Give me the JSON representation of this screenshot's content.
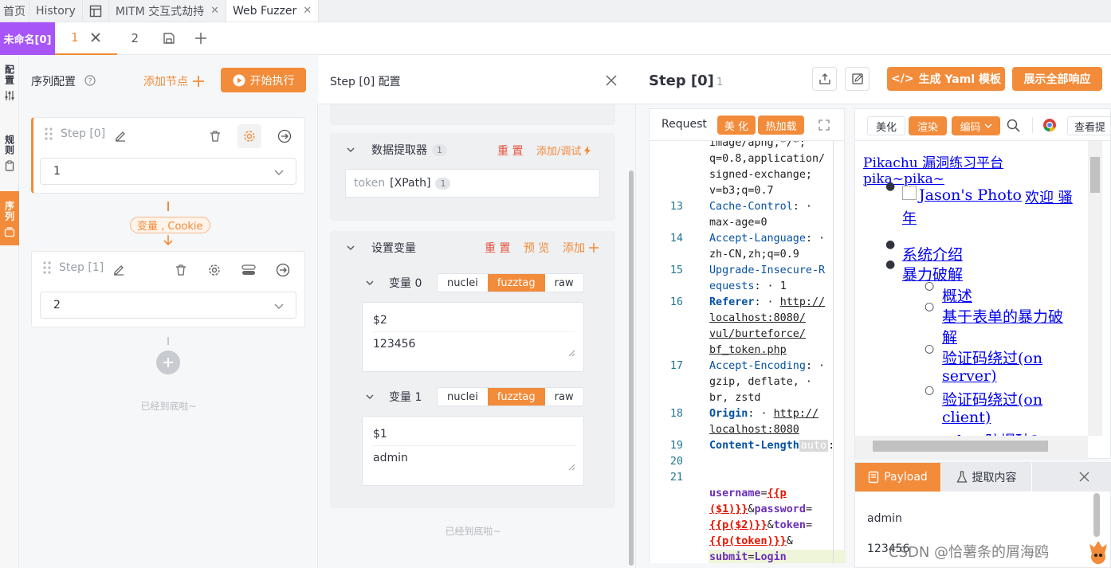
{
  "top_tabs": [
    {
      "label": "首页"
    },
    {
      "label": "History"
    },
    {
      "label": "MITM 交互式劫持"
    },
    {
      "label": "Web Fuzzer"
    }
  ],
  "sub_tabs": {
    "unnamed": "未命名[0]",
    "tab1": "1",
    "tab2": "2"
  },
  "vertical_tabs": [
    "配置",
    "规则",
    "序列"
  ],
  "seq_panel": {
    "title": "序列配置",
    "add_node": "添加节点",
    "start": "开始执行",
    "steps": [
      {
        "label": "Step [0]",
        "value": "1"
      },
      {
        "label": "Step [1]",
        "value": "2"
      }
    ],
    "connector": "变量 , Cookie",
    "bottom": "已经到底啦~"
  },
  "config_panel": {
    "title": "Step [0] 配置",
    "extractor": {
      "title": "数据提取器",
      "count": "1",
      "reset": "重 置",
      "add": "添加/调试",
      "item_name": "token",
      "item_type": "[XPath]",
      "item_count": "1"
    },
    "vars": {
      "title": "设置变量",
      "reset": "重 置",
      "preview": "预 览",
      "add": "添加",
      "items": [
        {
          "name": "变量 0",
          "key": "$2",
          "value": "123456"
        },
        {
          "name": "变量 1",
          "key": "$1",
          "value": "admin"
        }
      ],
      "seg": [
        "nuclei",
        "fuzztag",
        "raw"
      ]
    },
    "bottom": "已经到底啦~"
  },
  "step_panel": {
    "title": "Step [0]",
    "index": "1",
    "gen_yaml": "生成 Yaml 模板",
    "show_all": "展示全部响应",
    "request": {
      "title": "Request",
      "beautify": "美 化",
      "hotload": "热加载"
    },
    "response": {
      "beautify": "美化",
      "render": "渲染",
      "encode": "编码",
      "view": "查看提"
    },
    "payload_tab": "Payload",
    "extract_tab": "提取内容",
    "payload_values": [
      "admin",
      "123456"
    ],
    "watermark": "CSDN @恰薯条的屑海鸥"
  },
  "code": {
    "l0": "image/apng,*/*;",
    "l1": "q=0.8,application/",
    "l2": "signed-exchange;",
    "l3": "v=b3;q=0.7",
    "n13": "13",
    "k13": "Cache-Control",
    "v13": "max-age=0",
    "n14": "14",
    "k14": "Accept-Language",
    "v14": "zh-CN,zh;q=0.9",
    "n15": "15",
    "k15a": "Upgrade-Insecure-R",
    "k15b": "equests",
    "v15": "1",
    "n16": "16",
    "k16": "Referer",
    "v16a": "http://",
    "v16b": "localhost:8080/",
    "v16c": "vul/burteforce/",
    "v16d": "bf_token.php",
    "n17": "17",
    "k17": "Accept-Encoding",
    "v17a": "gzip, deflate,",
    "v17b": "br, zstd",
    "n18": "18",
    "k18": "Origin",
    "v18a": "http://",
    "v18b": "localhost:8080",
    "n19": "19",
    "k19": "Content-Length",
    "auto": "auto",
    "n20": "20",
    "n21": "21",
    "b1": "username",
    "b2": "{{p",
    "b3": "($1)}}",
    "b4": "password",
    "b5": "{{p($2)}}",
    "b6": "token",
    "b7": "{{p(token)}}",
    "b8": "submit",
    "b9": "Login"
  },
  "render": {
    "title": "Pikachu 漏洞练习平台 pika~pika~",
    "photo": "Jason's Photo",
    "welcome": "欢迎 骚",
    "welcome2": "年",
    "intro": "系统介绍",
    "brute": "暴力破解",
    "sub": [
      "概述",
      "基于表单的暴力破",
      "解",
      "验证码绕过(on",
      "server)",
      "验证码绕过(on",
      "client)",
      "token防爆破?"
    ]
  }
}
